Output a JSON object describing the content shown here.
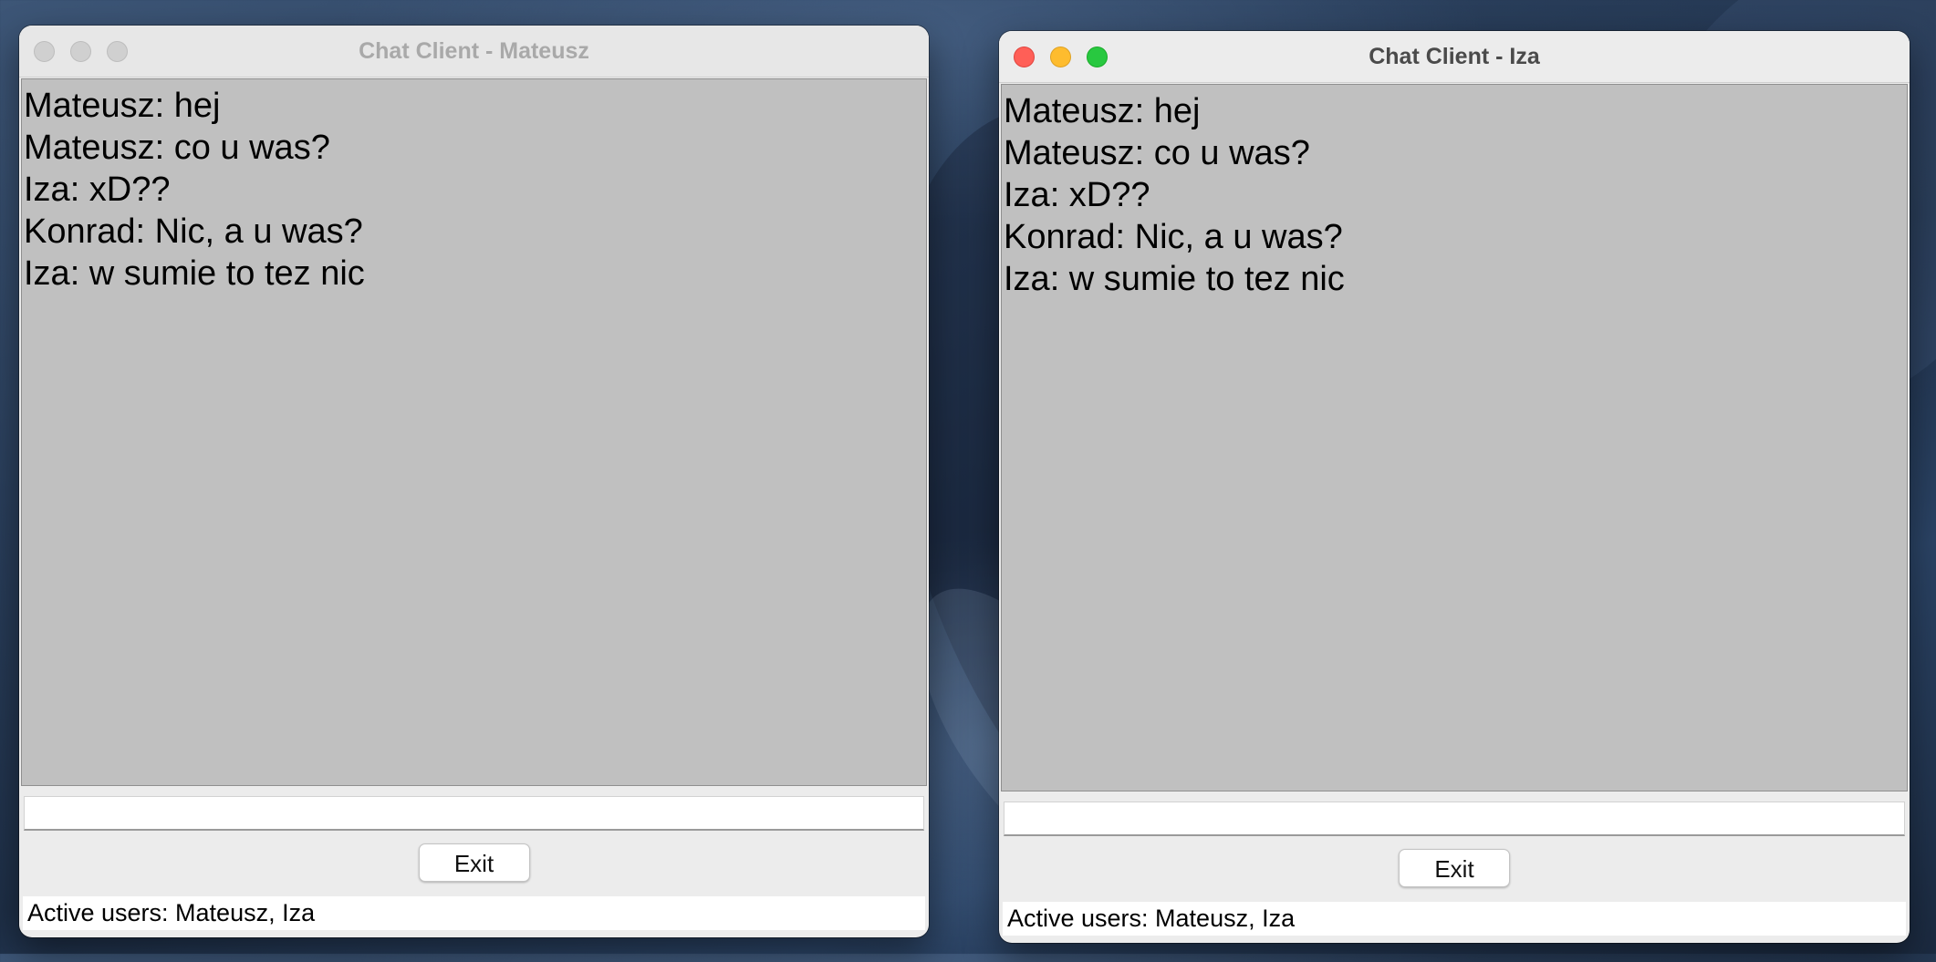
{
  "windows": [
    {
      "title": "Chat Client - Mateusz",
      "messages": [
        "Mateusz: hej",
        "Mateusz: co u was?",
        "Iza: xD??",
        "Konrad: Nic, a u was?",
        "Iza: w sumie to tez nic"
      ],
      "input_value": "",
      "exit_label": "Exit",
      "status": "Active users: Mateusz, Iza"
    },
    {
      "title": "Chat Client - Iza",
      "messages": [
        "Mateusz: hej",
        "Mateusz: co u was?",
        "Iza: xD??",
        "Konrad: Nic, a u was?",
        "Iza: w sumie to tez nic"
      ],
      "input_value": "",
      "exit_label": "Exit",
      "status": "Active users: Mateusz, Iza"
    }
  ]
}
